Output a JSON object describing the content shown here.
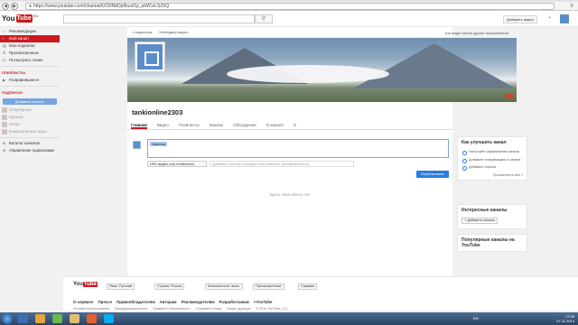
{
  "browser": {
    "url": "https://www.youtube.com/channel/UCRNbDp5kuxl1p_wWCeLSZ6Q",
    "back_glyph": "◀",
    "forward_glyph": "▶",
    "reload_glyph": "↻",
    "menu_glyph": "≡"
  },
  "masthead": {
    "logo_you": "You",
    "logo_tube": "Tube",
    "logo_sup": "RU",
    "search_glyph": "⚲",
    "upload_label": "Добавить видео",
    "bell_glyph": "🔔"
  },
  "sidebar": {
    "items": [
      {
        "label": "Рекомендации",
        "icon": "⌂"
      },
      {
        "label": "Мой канал",
        "icon": "▪",
        "active": true
      },
      {
        "label": "Мои подписки",
        "icon": "▤"
      },
      {
        "label": "Просмотренные",
        "icon": "⏱"
      },
      {
        "label": "Посмотреть позже",
        "icon": "◷"
      }
    ],
    "playlists_head": "ПЛЕЙЛИСТЫ",
    "playlist_items": [
      {
        "label": "Понравившиеся",
        "icon": "▶"
      }
    ],
    "subs_head": "ПОДПИСКИ",
    "subs_button": "Добавить каналы",
    "sub_items": [
      {
        "label": "Популярное"
      },
      {
        "label": "Музыка"
      },
      {
        "label": "Спорт"
      },
      {
        "label": "Компьютерные игры"
      }
    ],
    "bottom_items": [
      {
        "label": "Каталог каналов",
        "icon": "⊕"
      },
      {
        "label": "Управление подписками",
        "icon": "⚙"
      }
    ]
  },
  "channel": {
    "top_bar": {
      "subs": "1 подписчик",
      "manager": "Менеджер видео",
      "view_as": "Как видят канал другие пользователи"
    },
    "name": "tankionline2303",
    "tabs": [
      "Главная",
      "Видео",
      "Плейлисты",
      "Каналы",
      "Обсуждение",
      "О канале"
    ],
    "search_glyph": "⚲",
    "post": {
      "tag": "Заметки",
      "type_select": "URL видео или плейлиста",
      "link_placeholder": "Добавьте ссылку на видео или плейлист (необязательно)",
      "publish": "Опубликовать"
    },
    "empty_text": "Здесь пока ничего нет"
  },
  "right": {
    "improve": {
      "title": "Как улучшить канал",
      "items": [
        "Настройте оформление канала",
        "Добавьте информацию о канале",
        "Добавьте ссылки"
      ],
      "more": "Просмотреть все »"
    },
    "interesting": {
      "title": "Интересные каналы",
      "button": "+ Добавить каналы"
    },
    "popular": {
      "title": "Популярные каналы на YouTube"
    }
  },
  "footer": {
    "logo_you": "You",
    "logo_tube": "Tube",
    "lang": "Язык: Русский",
    "country": "Страна: Россия",
    "safety": "Безопасность: выкл.",
    "history": "Просмотренные",
    "help": "Справка",
    "links": [
      "О сервисе",
      "Прессе",
      "Правообладателям",
      "Авторам",
      "Рекламодателям",
      "Разработчикам",
      "+YouTube"
    ],
    "small_links": [
      "Условия использования",
      "Конфиденциальность",
      "Правила и безопасность",
      "Отправить отзыв",
      "Новые функции",
      "© 2014 YouTube, LLC"
    ]
  },
  "taskbar": {
    "lang": "EN",
    "time": "17:05",
    "date": "07.11.2014"
  },
  "colors": {
    "accent": "#cc181e",
    "link_blue": "#2a7ae2"
  }
}
